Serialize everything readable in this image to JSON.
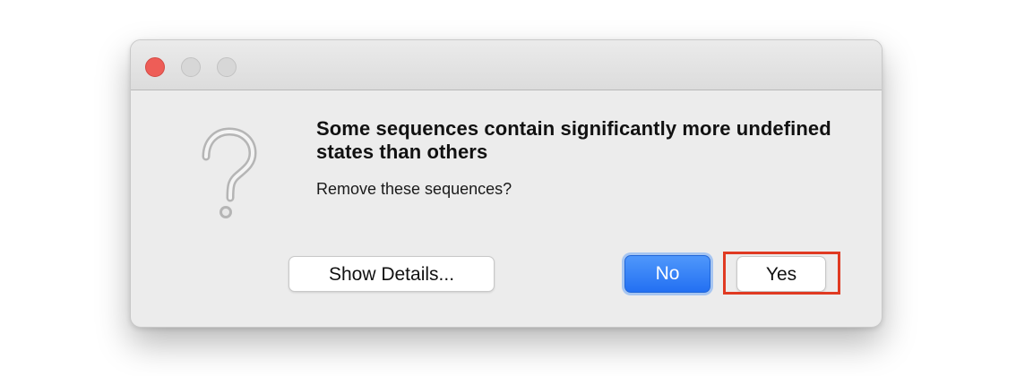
{
  "dialog": {
    "title": "Some sequences contain significantly more undefined states than others",
    "message": "Remove these sequences?",
    "icon": "question-mark-icon",
    "buttons": {
      "details_label": "Show Details...",
      "no_label": "No",
      "yes_label": "Yes"
    }
  },
  "window_controls": {
    "close": "close-icon",
    "minimize": "minimize-icon",
    "zoom": "zoom-icon"
  },
  "colors": {
    "close": "#ee5d57",
    "default_button": "#2370f2",
    "highlight": "#e03a22",
    "dialog_background": "#ececec"
  }
}
